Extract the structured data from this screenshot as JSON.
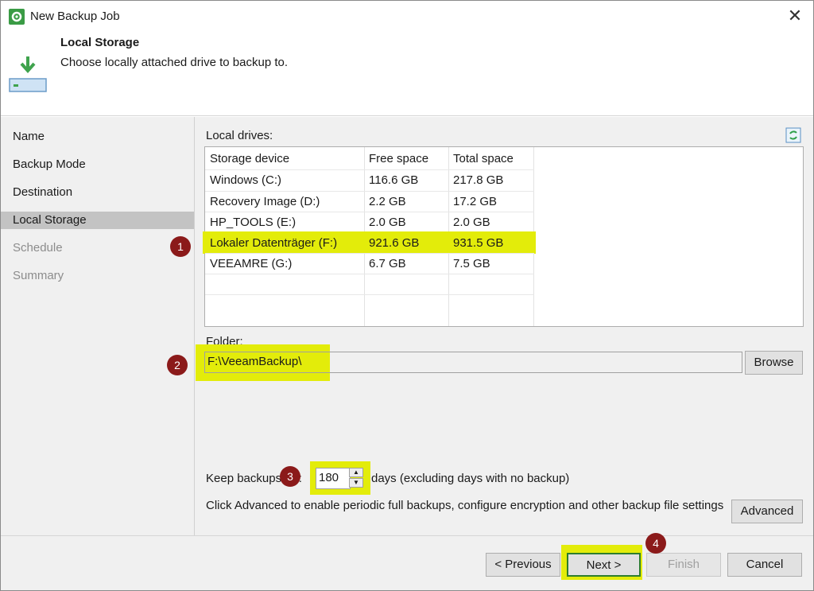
{
  "window": {
    "title": "New Backup Job",
    "close_glyph": "✕"
  },
  "header": {
    "title": "Local Storage",
    "subtitle": "Choose locally attached drive to backup to."
  },
  "sidebar": {
    "items": [
      {
        "label": "Name",
        "state": "normal"
      },
      {
        "label": "Backup Mode",
        "state": "normal"
      },
      {
        "label": "Destination",
        "state": "normal"
      },
      {
        "label": "Local Storage",
        "state": "active"
      },
      {
        "label": "Schedule",
        "state": "disabled"
      },
      {
        "label": "Summary",
        "state": "disabled"
      }
    ]
  },
  "drives": {
    "label": "Local drives:",
    "columns": [
      "Storage device",
      "Free space",
      "Total space"
    ],
    "rows": [
      [
        "Windows (C:)",
        "116.6 GB",
        "217.8 GB"
      ],
      [
        "Recovery Image (D:)",
        "2.2 GB",
        "17.2 GB"
      ],
      [
        "HP_TOOLS (E:)",
        "2.0 GB",
        "2.0 GB"
      ],
      [
        "Lokaler Datenträger (F:)",
        "921.6 GB",
        "931.5 GB"
      ],
      [
        "VEEAMRE (G:)",
        "6.7 GB",
        "7.5 GB"
      ]
    ],
    "selected_row": 3
  },
  "folder": {
    "label": "Folder:",
    "value": "F:\\VeeamBackup\\",
    "browse_label": "Browse"
  },
  "retention": {
    "prefix": "Keep backups for:",
    "value": "180",
    "suffix": "days (excluding days with no backup)"
  },
  "advanced": {
    "text": "Click Advanced to enable periodic full backups, configure encryption and other backup file settings",
    "button_label": "Advanced"
  },
  "footer": {
    "previous_label": "< Previous",
    "next_label": "Next >",
    "finish_label": "Finish",
    "cancel_label": "Cancel"
  },
  "badges": [
    "1",
    "2",
    "3",
    "4"
  ],
  "colors": {
    "highlight": "#e3ec0a",
    "badge": "#8b1a1a",
    "icon_green": "#3a9b45"
  }
}
